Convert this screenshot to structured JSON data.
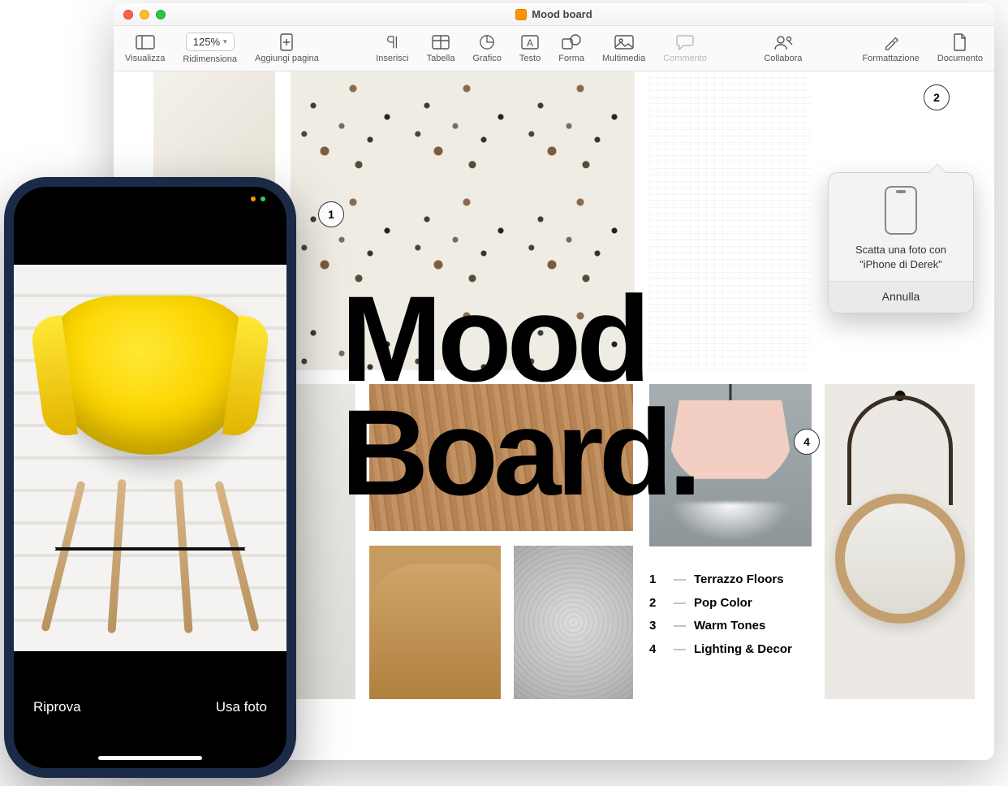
{
  "window": {
    "title": "Mood board"
  },
  "toolbar": {
    "view": "Visualizza",
    "zoom": "125%",
    "resize": "Ridimensiona",
    "addpage": "Aggiungi pagina",
    "insert": "Inserisci",
    "table": "Tabella",
    "chart": "Grafico",
    "text": "Testo",
    "shape": "Forma",
    "media": "Multimedia",
    "comment": "Commento",
    "collaborate": "Collabora",
    "format": "Formattazione",
    "document": "Documento"
  },
  "headline": {
    "line1": "Mood",
    "line2": "Board."
  },
  "callouts": {
    "c1": "1",
    "c2": "2",
    "c4": "4"
  },
  "legend": {
    "items": [
      {
        "num": "1",
        "text": "Terrazzo Floors"
      },
      {
        "num": "2",
        "text": "Pop Color"
      },
      {
        "num": "3",
        "text": "Warm Tones"
      },
      {
        "num": "4",
        "text": "Lighting & Decor"
      }
    ]
  },
  "popover": {
    "line1": "Scatta una foto con",
    "line2": "\"iPhone di Derek\"",
    "cancel": "Annulla"
  },
  "iphone": {
    "retake": "Riprova",
    "usephoto": "Usa foto"
  }
}
